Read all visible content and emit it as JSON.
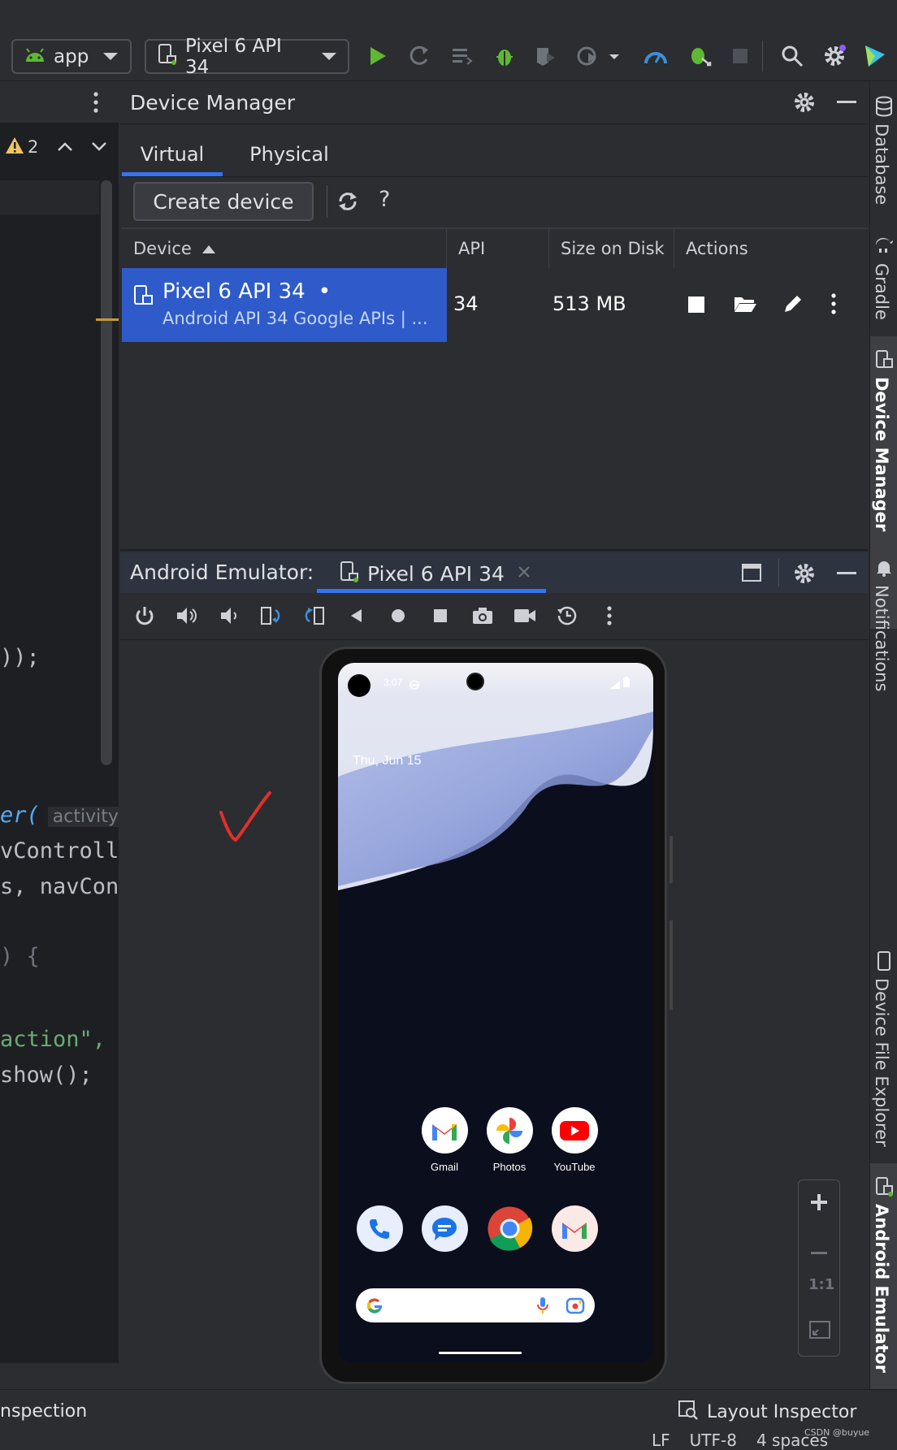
{
  "toolbar": {
    "run_config": "app",
    "device_selector": "Pixel 6 API 34"
  },
  "editor": {
    "warning_count": "2",
    "lines": [
      {
        "text": "));",
        "color": "#bcbec4"
      },
      {
        "text": "er(",
        "color": "#bcbec4",
        "hint": "activity"
      },
      {
        "text": "vControll",
        "color": "#bcbec4"
      },
      {
        "text": "s, navCont",
        "color": "#cf8e6d"
      },
      {
        "text": ") {",
        "color": "#bcbec4"
      },
      {
        "text": "action\",",
        "color": "#6aab73"
      },
      {
        "text": "show();",
        "color": "#bcbec4"
      }
    ]
  },
  "device_manager": {
    "title": "Device Manager",
    "tabs": [
      "Virtual",
      "Physical"
    ],
    "active_tab": "Virtual",
    "create_button": "Create device",
    "help_label": "?",
    "columns": [
      "Device",
      "API",
      "Size on Disk",
      "Actions"
    ],
    "rows": [
      {
        "name": "Pixel 6 API 34",
        "running_dot": "•",
        "subtitle": "Android API 34 Google APIs | ...",
        "api": "34",
        "size": "513 MB"
      }
    ]
  },
  "emulator": {
    "title": "Android Emulator:",
    "tab_label": "Pixel 6 API 34",
    "zoom_label": "1:1"
  },
  "phone": {
    "time": "3:07",
    "date": "Thu, Jun 15",
    "apps_row1": [
      {
        "label": "Gmail",
        "icon": "gmail-icon"
      },
      {
        "label": "Photos",
        "icon": "photos-icon"
      },
      {
        "label": "YouTube",
        "icon": "youtube-icon"
      }
    ],
    "dock": [
      {
        "icon": "phone-app-icon"
      },
      {
        "icon": "messages-icon"
      },
      {
        "icon": "chrome-icon"
      },
      {
        "icon": "gmail-icon"
      }
    ]
  },
  "right_stripe": [
    "Database",
    "Gradle",
    "Device Manager",
    "Notifications",
    "Device File Explorer",
    "Android Emulator"
  ],
  "status_bar": {
    "left": "nspection",
    "layout_inspector": "Layout Inspector",
    "encoding_items": [
      "LF",
      "UTF-8",
      "4 spaces"
    ],
    "watermark": "CSDN @buyue"
  },
  "colors": {
    "accent": "#3574f0",
    "selected_row": "#2e5bc9",
    "run_green": "#5fb832"
  }
}
